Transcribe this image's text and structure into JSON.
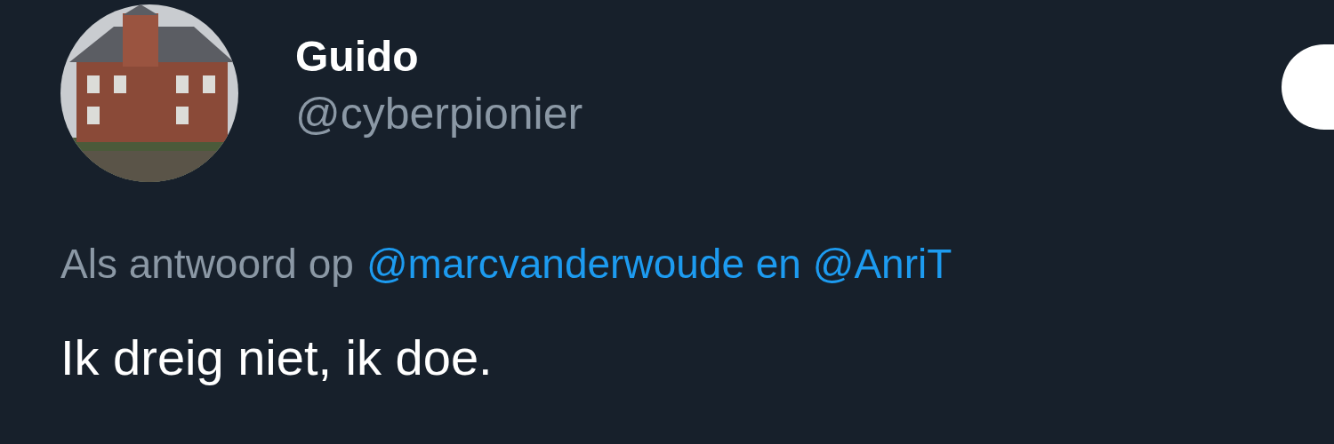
{
  "author": {
    "name": "Guido",
    "handle": "@cyberpionier"
  },
  "reply_to": {
    "prefix": "Als antwoord op",
    "mentions": "@marcvanderwoude en @AnriT"
  },
  "tweet": {
    "text": "Ik dreig niet, ik doe."
  }
}
